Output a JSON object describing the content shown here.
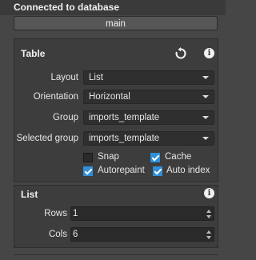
{
  "connection": {
    "title": "Connected to database",
    "db_button": "main"
  },
  "table_panel": {
    "title": "Table",
    "icons": {
      "reset": "reset-icon",
      "info": "info-icon"
    },
    "fields": {
      "layout": {
        "label": "Layout",
        "value": "List"
      },
      "orientation": {
        "label": "Orientation",
        "value": "Horizontal"
      },
      "group": {
        "label": "Group",
        "value": "imports_template"
      },
      "selected_group": {
        "label": "Selected group",
        "value": "imports_template"
      }
    },
    "checkboxes": {
      "snap": {
        "label": "Snap",
        "checked": false
      },
      "cache": {
        "label": "Cache",
        "checked": true
      },
      "autorepaint": {
        "label": "Autorepaint",
        "checked": true
      },
      "auto_index": {
        "label": "Auto index",
        "checked": true
      }
    }
  },
  "list_panel": {
    "title": "List",
    "icons": {
      "info": "info-icon"
    },
    "rows": {
      "label": "Rows",
      "value": "1"
    },
    "cols": {
      "label": "Cols",
      "value": "6"
    }
  },
  "colors": {
    "accent": "#2f8fd8",
    "background": "#464646",
    "panel": "#3d3d3d"
  }
}
